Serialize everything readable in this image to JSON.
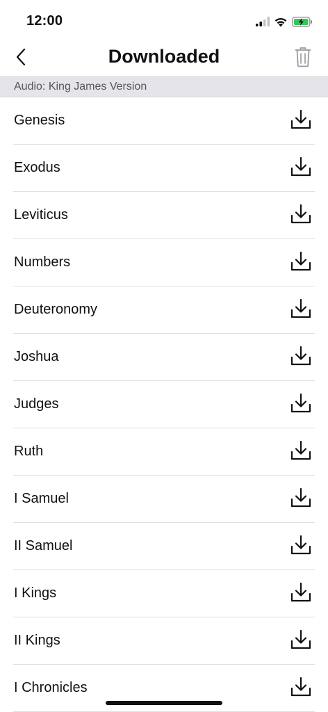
{
  "status_bar": {
    "time": "12:00",
    "icons": [
      "cellular-signal-icon",
      "wifi-icon",
      "battery-charging-icon"
    ],
    "battery_color": "#34c759"
  },
  "nav": {
    "title": "Downloaded",
    "back_icon": "chevron-left-icon",
    "trash_icon": "trash-icon"
  },
  "section": {
    "label": "Audio: King James Version"
  },
  "books": [
    {
      "name": "Genesis"
    },
    {
      "name": "Exodus"
    },
    {
      "name": "Leviticus"
    },
    {
      "name": "Numbers"
    },
    {
      "name": "Deuteronomy"
    },
    {
      "name": "Joshua"
    },
    {
      "name": "Judges"
    },
    {
      "name": "Ruth"
    },
    {
      "name": "I Samuel"
    },
    {
      "name": "II Samuel"
    },
    {
      "name": "I Kings"
    },
    {
      "name": "II Kings"
    },
    {
      "name": "I Chronicles"
    }
  ],
  "row_icon": "download-icon"
}
